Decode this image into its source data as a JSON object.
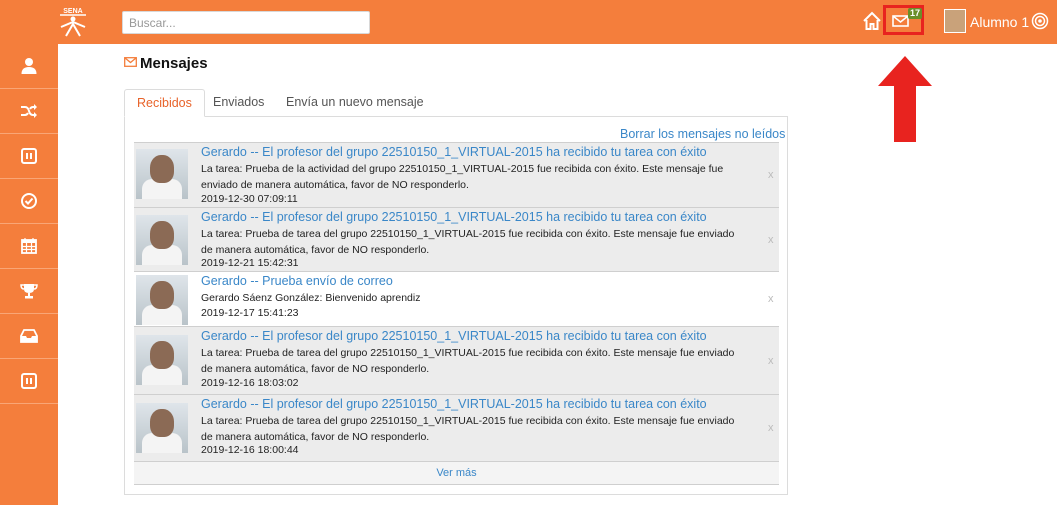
{
  "header": {
    "search_placeholder": "Buscar...",
    "mail_count": "17",
    "user_name": "Alumno 1"
  },
  "sidebar": {
    "items": [
      {
        "icon": "user-icon"
      },
      {
        "icon": "shuffle-icon"
      },
      {
        "icon": "book-icon"
      },
      {
        "icon": "check-circle-icon"
      },
      {
        "icon": "calendar-icon"
      },
      {
        "icon": "trophy-icon"
      },
      {
        "icon": "inbox-icon"
      },
      {
        "icon": "book-icon"
      }
    ]
  },
  "page": {
    "title": "Mensajes",
    "tabs": [
      "Recibidos",
      "Enviados",
      "Envía un nuevo mensaje"
    ],
    "clear_label": "Borrar los mensajes no leídos",
    "more_label": "Ver más"
  },
  "messages": [
    {
      "subject": "Gerardo -- El profesor del grupo 22510150_1_VIRTUAL-2015 ha recibido tu tarea con éxito",
      "body": "La tarea: Prueba de la actividad del grupo 22510150_1_VIRTUAL-2015 fue recibida con éxito. Este mensaje fue enviado de manera automática, favor de NO responderlo.",
      "date": "2019-12-30 07:09:11",
      "close": "x"
    },
    {
      "subject": "Gerardo -- El profesor del grupo 22510150_1_VIRTUAL-2015 ha recibido tu tarea con éxito",
      "body": "La tarea: Prueba de tarea del grupo 22510150_1_VIRTUAL-2015 fue recibida con éxito. Este mensaje fue enviado de manera automática, favor de NO responderlo.",
      "date": "2019-12-21 15:42:31",
      "close": "x"
    },
    {
      "subject": "Gerardo -- Prueba envío de correo",
      "body": "Gerardo Sáenz González: Bienvenido aprendiz",
      "date": "2019-12-17 15:41:23",
      "close": "x"
    },
    {
      "subject": "Gerardo -- El profesor del grupo 22510150_1_VIRTUAL-2015 ha recibido tu tarea con éxito",
      "body": "La tarea: Prueba de tarea del grupo 22510150_1_VIRTUAL-2015 fue recibida con éxito. Este mensaje fue enviado de manera automática, favor de NO responderlo.",
      "date": "2019-12-16 18:03:02",
      "close": "x"
    },
    {
      "subject": "Gerardo -- El profesor del grupo 22510150_1_VIRTUAL-2015 ha recibido tu tarea con éxito",
      "body": "La tarea: Prueba de tarea del grupo 22510150_1_VIRTUAL-2015 fue recibida con éxito. Este mensaje fue enviado de manera automática, favor de NO responderlo.",
      "date": "2019-12-16 18:00:44",
      "close": "x"
    }
  ],
  "colors": {
    "brand": "#f47e3c",
    "link": "#3a87c8",
    "highlight": "#e8231f"
  }
}
